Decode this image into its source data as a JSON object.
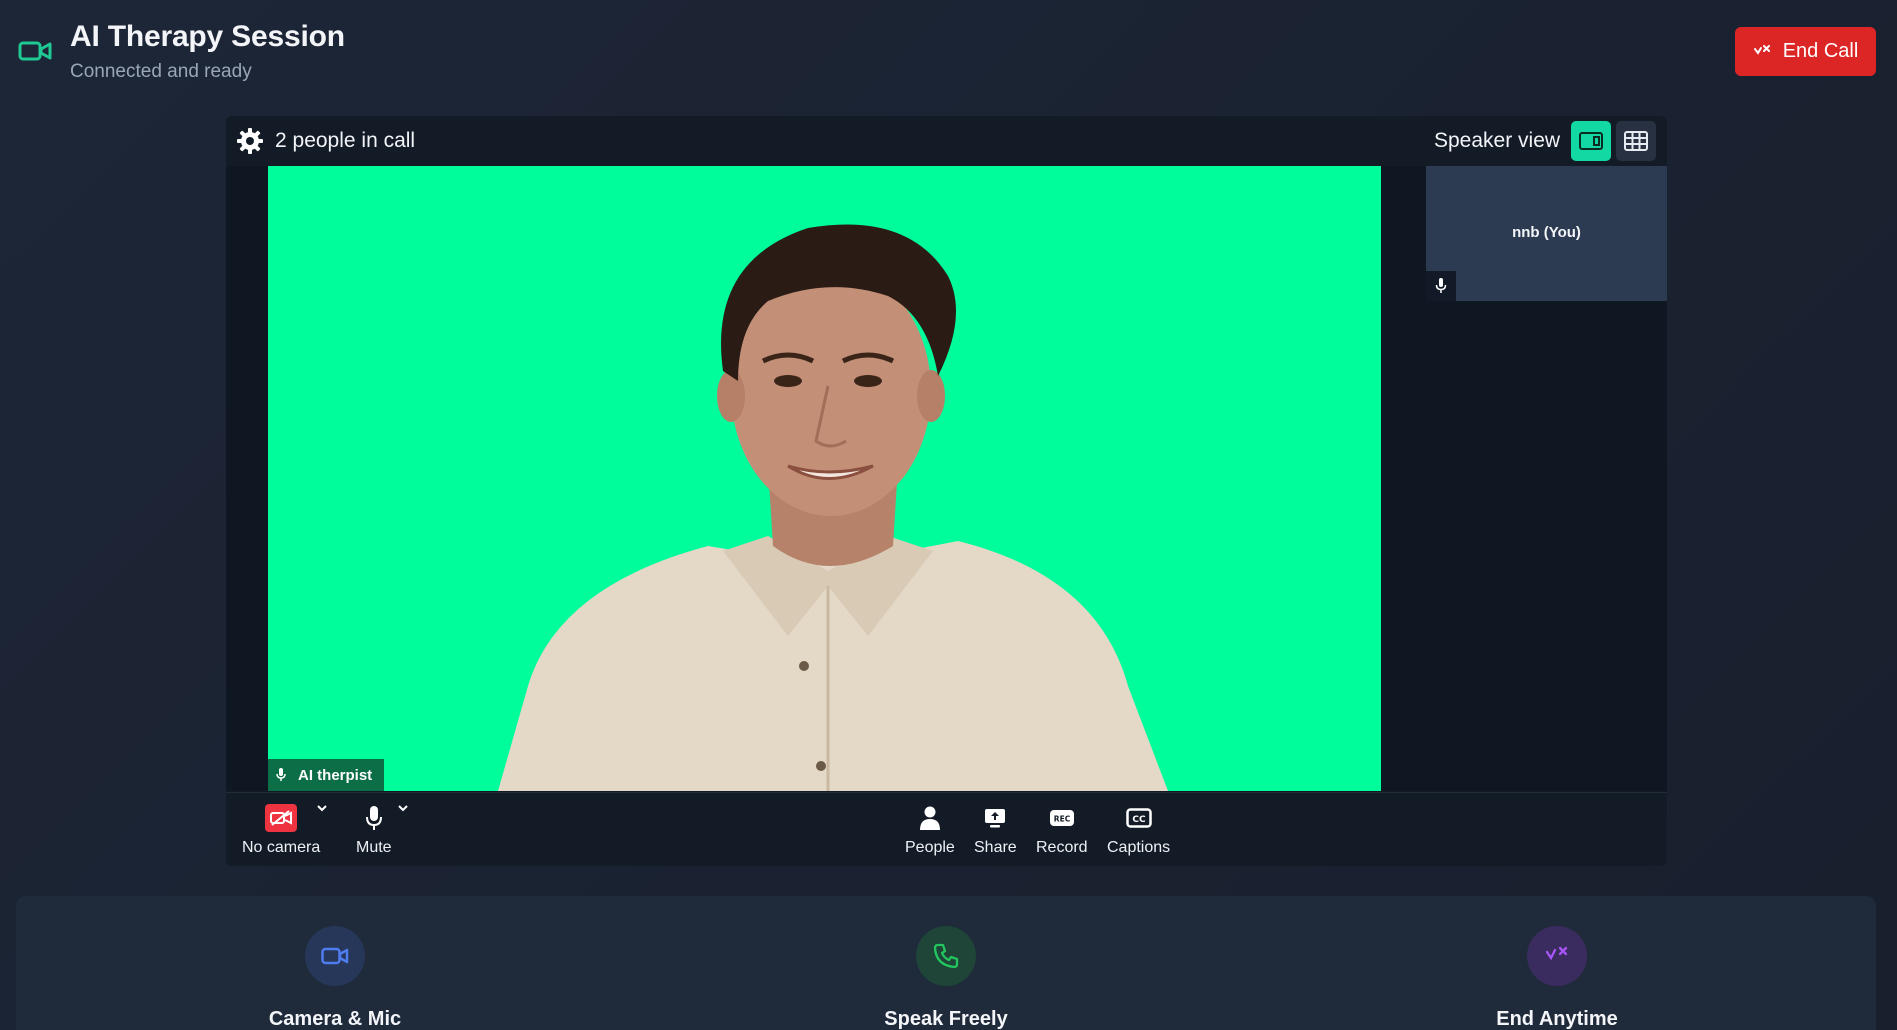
{
  "header": {
    "title": "AI Therapy Session",
    "subtitle": "Connected and ready",
    "end_call_label": "End Call",
    "logo_icon": "video-camera-icon"
  },
  "call": {
    "people_count": "2 people in call",
    "view_label": "Speaker view",
    "views": [
      "speaker-view-icon",
      "grid-view-icon"
    ],
    "active_view": "speaker",
    "main_participant": "AI therpist",
    "self_participant": "nnb (You)",
    "controls_left": [
      {
        "label": "No camera",
        "icon": "camera-off-icon"
      },
      {
        "label": "Mute",
        "icon": "microphone-icon"
      }
    ],
    "controls_center": [
      {
        "label": "People",
        "icon": "person-icon"
      },
      {
        "label": "Share",
        "icon": "share-screen-icon"
      },
      {
        "label": "Record",
        "icon": "record-icon",
        "badge": "REC"
      },
      {
        "label": "Captions",
        "icon": "captions-icon",
        "badge": "CC"
      }
    ]
  },
  "features": [
    {
      "label": "Camera & Mic",
      "icon": "video-camera-icon",
      "color": "#4f7df0"
    },
    {
      "label": "Speak Freely",
      "icon": "phone-icon",
      "color": "#22c55e"
    },
    {
      "label": "End Anytime",
      "icon": "phone-hangup-icon",
      "color": "#a855f7"
    }
  ],
  "colors": {
    "background": "#1b2433",
    "accent": "#12d9a3",
    "danger": "#dc2626",
    "green_screen": "#00fd9c"
  }
}
